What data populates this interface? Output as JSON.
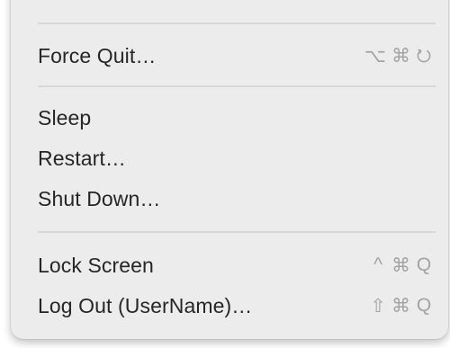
{
  "menu": {
    "items": [
      {
        "label": "Force Quit…",
        "shortcut": {
          "option": "⌥",
          "command": "⌘",
          "key_icon": "power-icon"
        }
      },
      {
        "label": "Sleep"
      },
      {
        "label": "Restart…"
      },
      {
        "label": "Shut Down…"
      },
      {
        "label": "Lock Screen",
        "shortcut": {
          "control": "^",
          "command": "⌘",
          "key": "Q"
        }
      },
      {
        "label": "Log Out (UserName)…",
        "shortcut": {
          "shift": "⇧",
          "command": "⌘",
          "key": "Q"
        }
      }
    ]
  }
}
